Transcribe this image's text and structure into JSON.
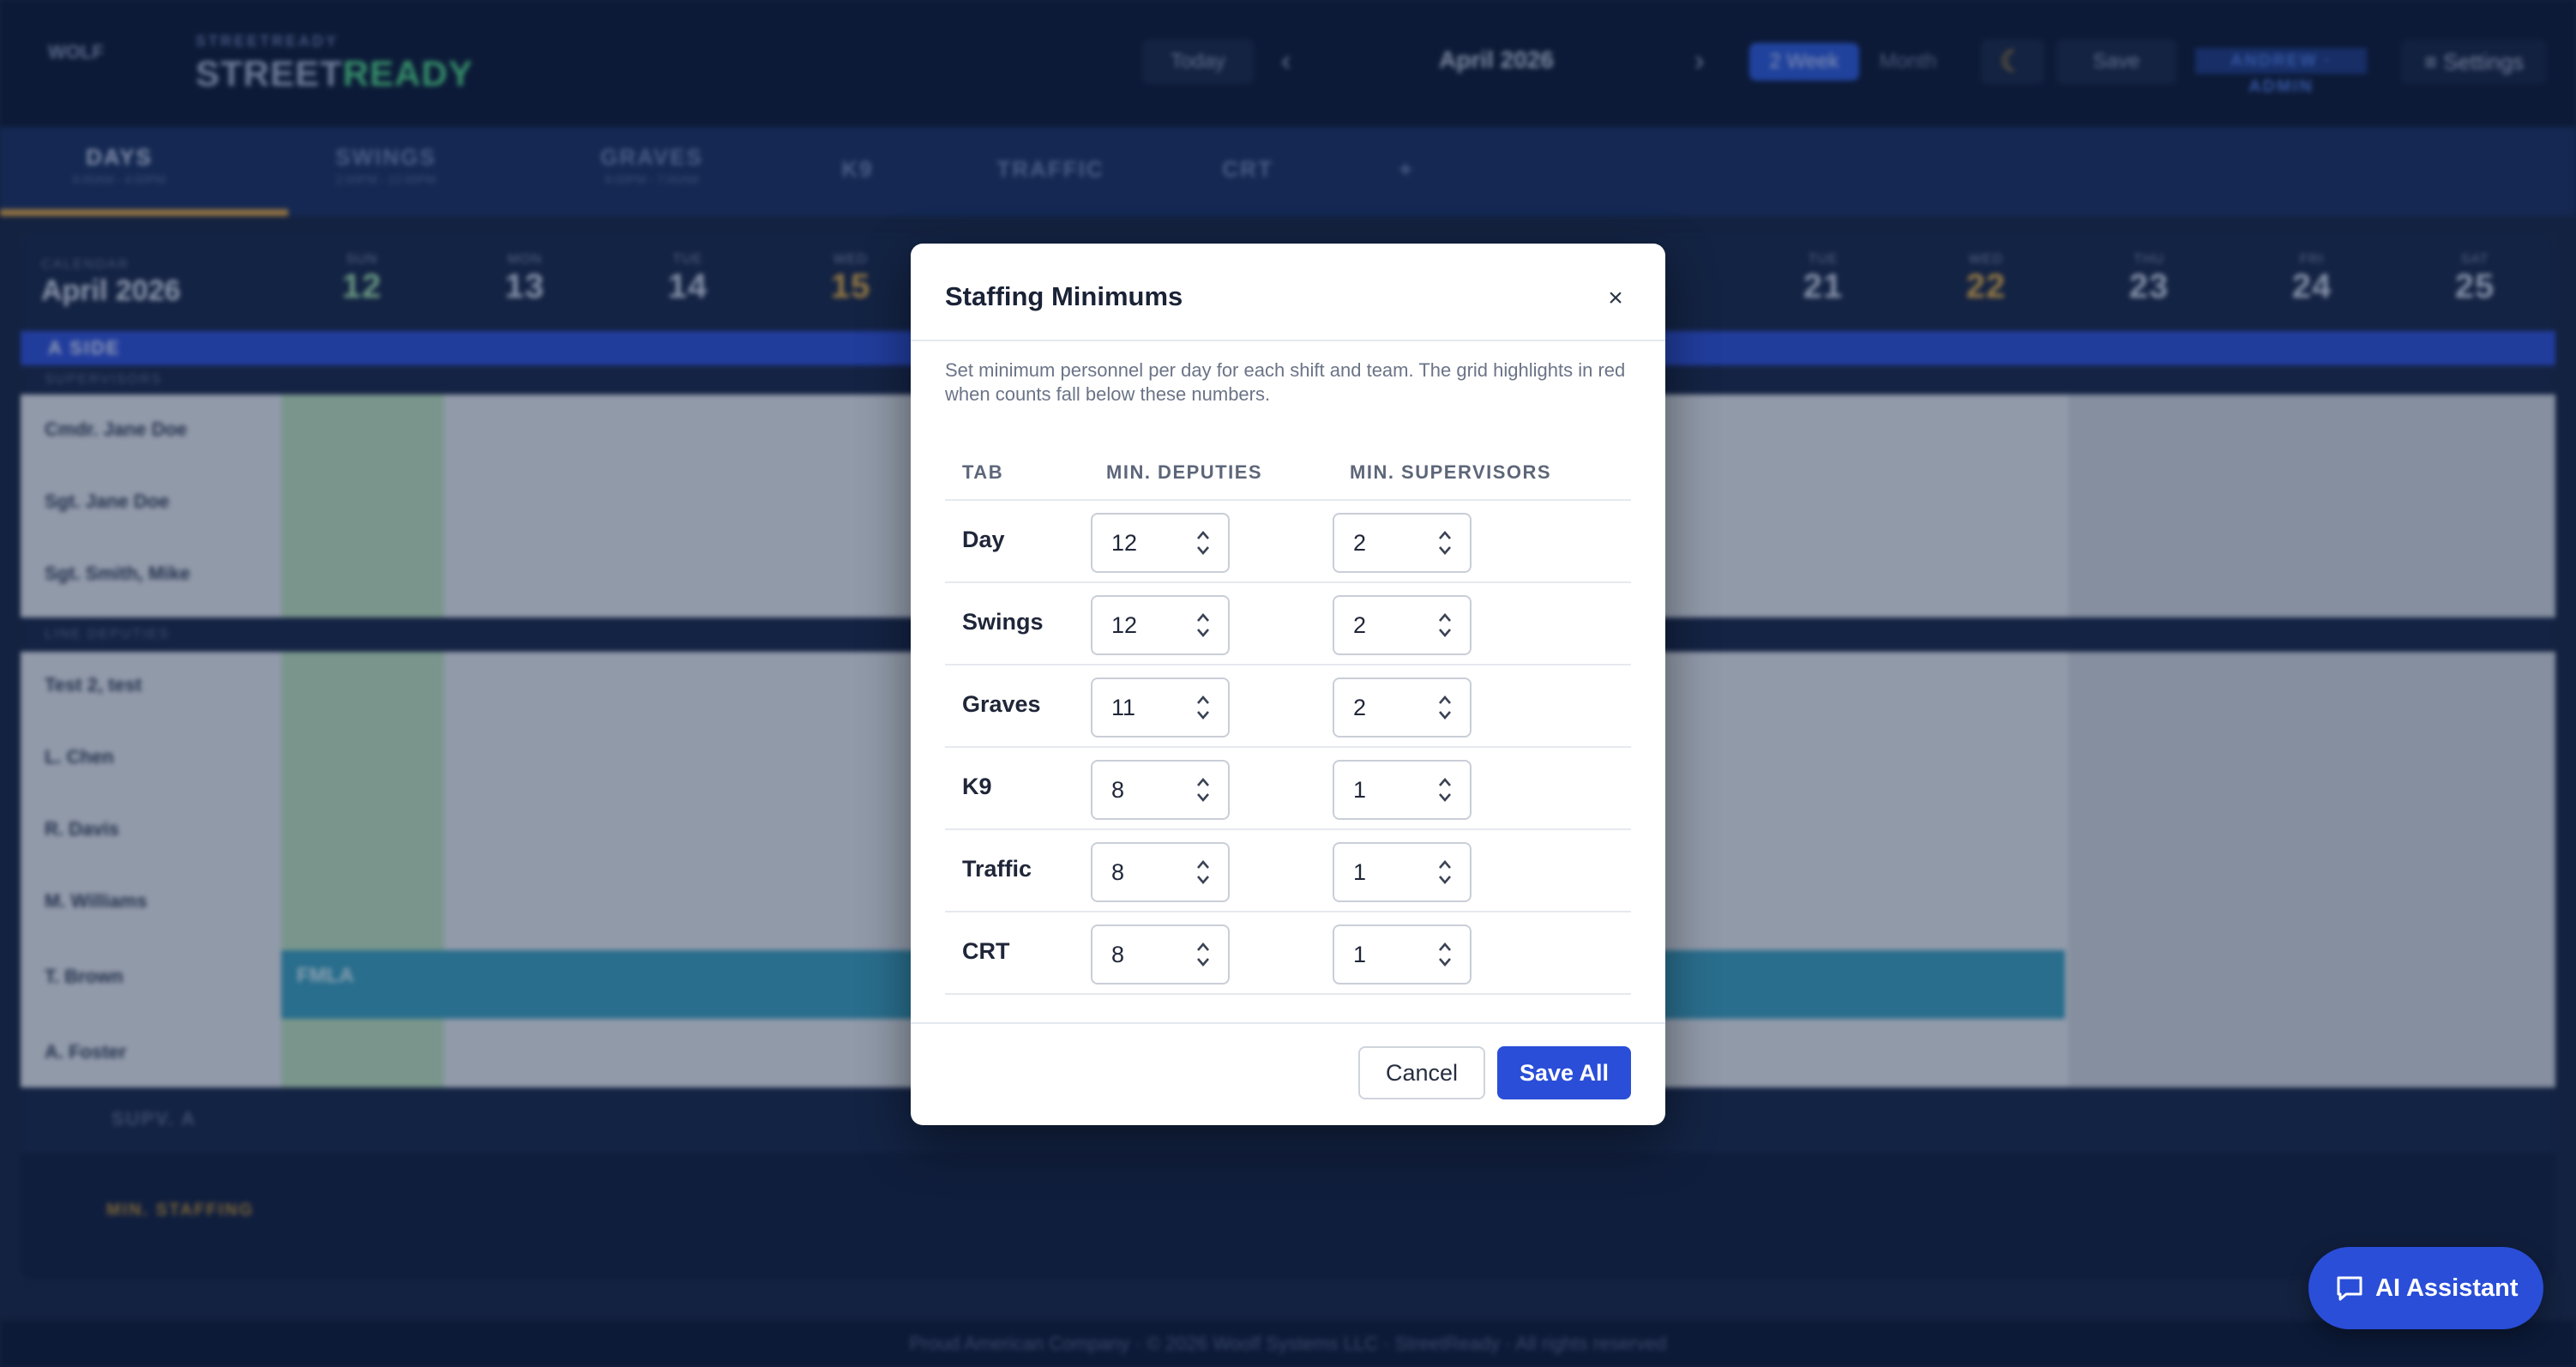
{
  "app": {
    "brand_small": "STREETREADY",
    "brand_street": "STREET",
    "brand_ready": "READY",
    "logo": "WOLF",
    "today_label": "Today",
    "month_label": "April 2026",
    "week_label": "2 Week",
    "month_view_label": "Month",
    "save_label": "Save",
    "user_label": "ANDREW · ADMIN",
    "settings_label": "≡ Settings",
    "tabs": [
      {
        "label": "DAYS",
        "sub": "6:00AM - 4:00PM"
      },
      {
        "label": "SWINGS",
        "sub": "2:00PM - 12:00PM"
      },
      {
        "label": "GRAVES",
        "sub": "8:00PM - 7:00AM"
      },
      {
        "label": "K9",
        "sub": ""
      },
      {
        "label": "TRAFFIC",
        "sub": ""
      },
      {
        "label": "CRT",
        "sub": ""
      },
      {
        "label": "+",
        "sub": ""
      }
    ],
    "grid": {
      "calendar_label": "CALENDAR",
      "month": "April 2026",
      "days": [
        {
          "dow": "SUN",
          "num": "12"
        },
        {
          "dow": "MON",
          "num": "13"
        },
        {
          "dow": "TUE",
          "num": "14"
        },
        {
          "dow": "WED",
          "num": "15"
        },
        {
          "dow": "TUE",
          "num": "21"
        },
        {
          "dow": "WED",
          "num": "22"
        },
        {
          "dow": "THU",
          "num": "23"
        },
        {
          "dow": "FRI",
          "num": "24"
        },
        {
          "dow": "SAT",
          "num": "25"
        }
      ],
      "a_side": "A SIDE",
      "supervisors": "SUPERVISORS",
      "line_deputies": "LINE DEPUTIES",
      "people": [
        "Cmdr. Jane Doe",
        "Sgt. Jane Doe",
        "Sgt. Smith, Mike",
        "Test 2, test",
        "L. Chen",
        "R. Davis",
        "M. Williams",
        "T. Brown",
        "A. Foster"
      ],
      "fmla": "FMLA",
      "supv_a": "SUPV. A",
      "min_staffing": "MIN. STAFFING"
    },
    "footer": "Proud American Company · © 2026 Woolf Systems LLC · StreetReady · All rights reserved"
  },
  "modal": {
    "title": "Staffing Minimums",
    "close": "×",
    "description": "Set minimum personnel per day for each shift and team. The grid highlights in red when counts fall below these numbers.",
    "col_tab": "TAB",
    "col_deputies": "MIN. DEPUTIES",
    "col_supervisors": "MIN. SUPERVISORS",
    "rows": [
      {
        "tab": "Day",
        "deputies": "12",
        "supervisors": "2"
      },
      {
        "tab": "Swings",
        "deputies": "12",
        "supervisors": "2"
      },
      {
        "tab": "Graves",
        "deputies": "11",
        "supervisors": "2"
      },
      {
        "tab": "K9",
        "deputies": "8",
        "supervisors": "1"
      },
      {
        "tab": "Traffic",
        "deputies": "8",
        "supervisors": "1"
      },
      {
        "tab": "CRT",
        "deputies": "8",
        "supervisors": "1"
      }
    ],
    "cancel_label": "Cancel",
    "save_label": "Save All"
  },
  "ai_assistant": {
    "label": "AI Assistant"
  },
  "colors": {
    "accent": "#2a4ed8",
    "topbar": "#0f1e3d",
    "tabbar": "#1b3467",
    "aside": "#2f53d8",
    "ready_green": "#4fd08a"
  }
}
